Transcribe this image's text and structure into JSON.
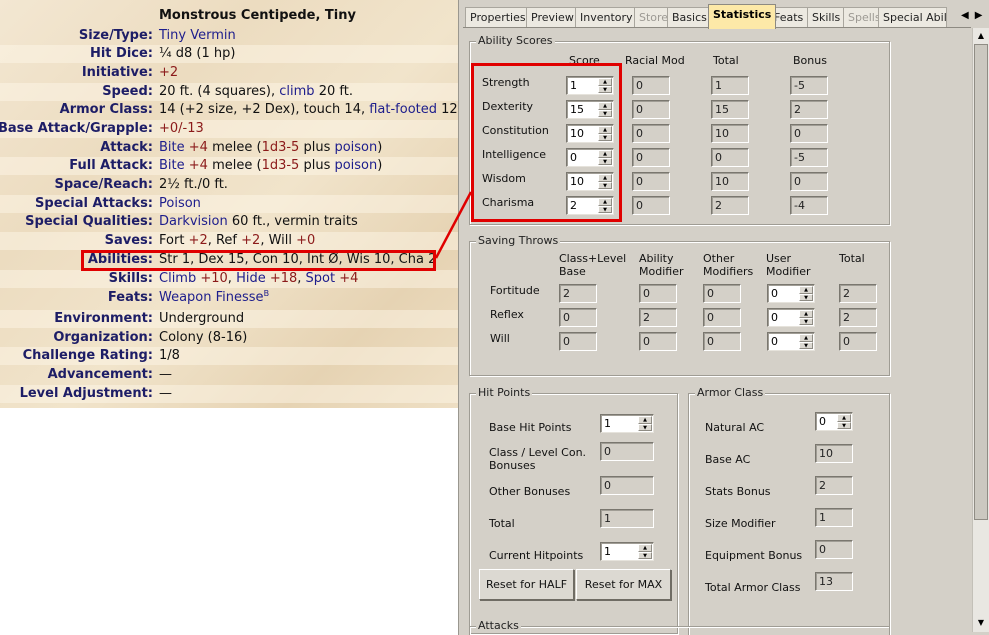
{
  "statblock": {
    "title": "Monstrous Centipede, Tiny",
    "rows": [
      {
        "label": "Size/Type:",
        "value": "Tiny Vermin"
      },
      {
        "label": "Hit Dice:",
        "value": "¼ d8 (1 hp)"
      },
      {
        "label": "Initiative:",
        "value": "+2"
      },
      {
        "label": "Speed:",
        "value_a": "20 ft. (4 squares), ",
        "value_b": "climb",
        "value_c": " 20 ft."
      },
      {
        "label": "Armor Class:",
        "value_a": "14 (+2 size, +2 Dex), touch 14, ",
        "value_b": "flat-footed",
        "value_c": " 12"
      },
      {
        "label": "Base Attack/Grapple:",
        "value": "+0/-13"
      },
      {
        "label": "Attack:",
        "bite": "Bite",
        "bonus": "+4",
        "melee": " melee (",
        "dmg": "1d3-5",
        "plus": " plus ",
        "poison": "poison",
        "end": ")"
      },
      {
        "label": "Full Attack:",
        "bite": "Bite",
        "bonus": "+4",
        "melee": " melee (",
        "dmg": "1d3-5",
        "plus": " plus ",
        "poison": "poison",
        "end": ")"
      },
      {
        "label": "Space/Reach:",
        "value": "2½ ft./0 ft."
      },
      {
        "label": "Special Attacks:",
        "value": "Poison"
      },
      {
        "label": "Special Qualities:",
        "value_a": "Darkvision",
        "value_b": " 60 ft., vermin traits"
      },
      {
        "label": "Saves:",
        "fort": "Fort ",
        "fort_v": "+2",
        "ref": ", Ref ",
        "ref_v": "+2",
        "will": ", Will ",
        "will_v": "+0"
      },
      {
        "label": "Abilities:",
        "value": "Str 1, Dex 15, Con 10, Int Ø, Wis 10, Cha 2"
      },
      {
        "label": "Skills:",
        "climb": "Climb",
        "climb_v": "+10",
        "hide": "Hide",
        "hide_v": "+18",
        "spot": "Spot",
        "spot_v": "+4"
      },
      {
        "label": "Feats:",
        "value": "Weapon Finesse",
        "sup": "B"
      },
      {
        "label": "Environment:",
        "value": "Underground"
      },
      {
        "label": "Organization:",
        "value": "Colony (8-16)"
      },
      {
        "label": "Challenge Rating:",
        "value": "1/8"
      },
      {
        "label": "Advancement:",
        "value": "—"
      },
      {
        "label": "Level Adjustment:",
        "value": "—"
      }
    ]
  },
  "editor": {
    "tabs": [
      {
        "label": "Properties",
        "state": "normal"
      },
      {
        "label": "Preview",
        "state": "normal"
      },
      {
        "label": "Inventory",
        "state": "normal"
      },
      {
        "label": "Store",
        "state": "disabled"
      },
      {
        "label": "Basics",
        "state": "normal"
      },
      {
        "label": "Statistics",
        "state": "active"
      },
      {
        "label": "Feats",
        "state": "normal"
      },
      {
        "label": "Skills",
        "state": "normal"
      },
      {
        "label": "Spells",
        "state": "disabled"
      },
      {
        "label": "Special Abili",
        "state": "normal"
      }
    ],
    "ability_scores": {
      "title": "Ability Scores",
      "headers": [
        "Score",
        "Racial Mod",
        "Total",
        "Bonus"
      ],
      "rows": [
        {
          "name": "Strength",
          "score": "1",
          "racial": "0",
          "total": "1",
          "bonus": "-5"
        },
        {
          "name": "Dexterity",
          "score": "15",
          "racial": "0",
          "total": "15",
          "bonus": "2"
        },
        {
          "name": "Constitution",
          "score": "10",
          "racial": "0",
          "total": "10",
          "bonus": "0"
        },
        {
          "name": "Intelligence",
          "score": "0",
          "racial": "0",
          "total": "0",
          "bonus": "-5"
        },
        {
          "name": "Wisdom",
          "score": "10",
          "racial": "0",
          "total": "10",
          "bonus": "0"
        },
        {
          "name": "Charisma",
          "score": "2",
          "racial": "0",
          "total": "2",
          "bonus": "-4"
        }
      ]
    },
    "saving_throws": {
      "title": "Saving Throws",
      "headers": [
        "Class+Level\nBase",
        "Ability\nModifier",
        "Other\nModifiers",
        "User\nModifier",
        "Total"
      ],
      "rows": [
        {
          "name": "Fortitude",
          "base": "2",
          "ability": "0",
          "other": "0",
          "user": "0",
          "total": "2"
        },
        {
          "name": "Reflex",
          "base": "0",
          "ability": "2",
          "other": "0",
          "user": "0",
          "total": "2"
        },
        {
          "name": "Will",
          "base": "0",
          "ability": "0",
          "other": "0",
          "user": "0",
          "total": "0"
        }
      ]
    },
    "hit_points": {
      "title": "Hit Points",
      "base_label": "Base Hit Points",
      "base_value": "1",
      "con_label_1": "Class / Level Con.",
      "con_label_2": "Bonuses",
      "con_value": "0",
      "other_label": "Other Bonuses",
      "other_value": "0",
      "total_label": "Total",
      "total_value": "1",
      "current_label": "Current Hitpoints",
      "current_value": "1",
      "reset_half": "Reset for HALF",
      "reset_max": "Reset for MAX"
    },
    "armor_class": {
      "title": "Armor Class",
      "natural_label": "Natural AC",
      "natural_value": "0",
      "base_label": "Base AC",
      "base_value": "10",
      "stats_label": "Stats Bonus",
      "stats_value": "2",
      "size_label": "Size Modifier",
      "size_value": "1",
      "equip_label": "Equipment Bonus",
      "equip_value": "0",
      "total_label": "Total Armor Class",
      "total_value": "13"
    },
    "attacks": {
      "title": "Attacks"
    }
  }
}
